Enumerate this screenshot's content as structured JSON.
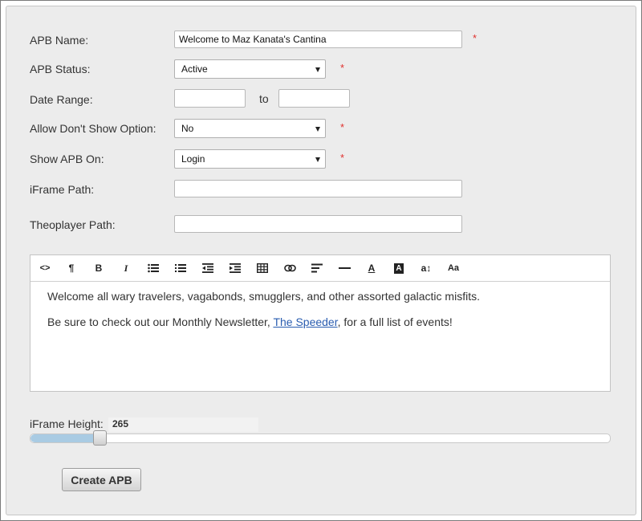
{
  "form": {
    "apb_name_label": "APB Name:",
    "apb_name_value": "Welcome to Maz Kanata's Cantina",
    "apb_status_label": "APB Status:",
    "apb_status_value": "Active",
    "date_range_label": "Date Range:",
    "date_range_to": "to",
    "date_from_value": "",
    "date_to_value": "",
    "allow_dont_show_label": "Allow Don't Show Option:",
    "allow_dont_show_value": "No",
    "show_apb_on_label": "Show APB On:",
    "show_apb_on_value": "Login",
    "iframe_path_label": "iFrame Path:",
    "iframe_path_value": "",
    "theoplayer_path_label": "Theoplayer Path:",
    "theoplayer_path_value": "",
    "required_mark": "*"
  },
  "toolbar": {
    "code": "<>",
    "paragraph": "¶",
    "bold": "B",
    "italic": "I",
    "unordered_list": "unordered-list-icon",
    "ordered_list": "ordered-list-icon",
    "outdent": "outdent-icon",
    "indent": "indent-icon",
    "table": "table-icon",
    "link": "link-icon",
    "align": "align-left-icon",
    "hr": "horizontal-rule-icon",
    "font_color": "A",
    "back_color": "A",
    "font_size": "a↕",
    "font_family": "Aa"
  },
  "editor": {
    "line1": "Welcome all wary travelers, vagabonds, smugglers, and other assorted galactic misfits.",
    "line2_before": "Be sure to check out our Monthly Newsletter, ",
    "line2_link": "The Speeder",
    "line2_after": ", for a full list of events!"
  },
  "iframe_height": {
    "label": "iFrame Height:",
    "value": "265",
    "slider_fraction": 0.12
  },
  "actions": {
    "create_label": "Create APB"
  },
  "colors": {
    "required": "#e0312e",
    "link": "#2a5db0",
    "slider_fill": "#a9cbe3"
  }
}
